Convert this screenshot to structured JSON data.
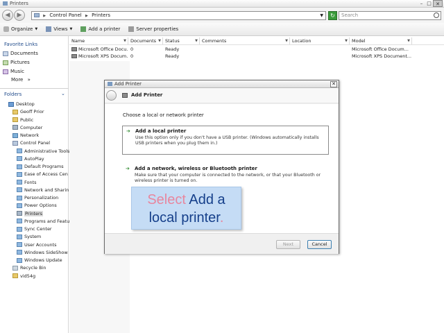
{
  "window": {
    "title": "Printers"
  },
  "window_buttons": {
    "minimize": "–",
    "maximize": "□",
    "close": "✕"
  },
  "address": {
    "crumbs": [
      "Control Panel",
      "Printers"
    ],
    "search_placeholder": "Search"
  },
  "toolbar": {
    "organize": "Organize",
    "views": "Views",
    "add_printer": "Add a printer",
    "server_properties": "Server properties"
  },
  "favorites": {
    "title": "Favorite Links",
    "items": [
      "Documents",
      "Pictures",
      "Music"
    ],
    "more": "More",
    "more_glyph": "»"
  },
  "folders": {
    "title": "Folders",
    "tree": [
      {
        "label": "Desktop",
        "icon": "desktop-icon"
      },
      {
        "label": "Geoff Prior",
        "icon": "folder-icon"
      },
      {
        "label": "Public",
        "icon": "folder-icon"
      },
      {
        "label": "Computer",
        "icon": "computer-icon"
      },
      {
        "label": "Network",
        "icon": "network-icon"
      },
      {
        "label": "Control Panel",
        "icon": "control-panel-icon"
      },
      {
        "label": "Administrative Tools",
        "icon": "cp-icon"
      },
      {
        "label": "AutoPlay",
        "icon": "cp-icon"
      },
      {
        "label": "Default Programs",
        "icon": "cp-icon"
      },
      {
        "label": "Ease of Access Cen",
        "icon": "cp-icon"
      },
      {
        "label": "Fonts",
        "icon": "cp-icon"
      },
      {
        "label": "Network and Sharin",
        "icon": "cp-icon"
      },
      {
        "label": "Personalization",
        "icon": "cp-icon"
      },
      {
        "label": "Power Options",
        "icon": "cp-icon"
      },
      {
        "label": "Printers",
        "icon": "printer-icon"
      },
      {
        "label": "Programs and Featu",
        "icon": "cp-icon"
      },
      {
        "label": "Sync Center",
        "icon": "cp-icon"
      },
      {
        "label": "System",
        "icon": "cp-icon"
      },
      {
        "label": "User Accounts",
        "icon": "cp-icon"
      },
      {
        "label": "Windows SideShow",
        "icon": "cp-icon"
      },
      {
        "label": "Windows Update",
        "icon": "cp-icon"
      },
      {
        "label": "Recycle Bin",
        "icon": "recycle-bin-icon"
      },
      {
        "label": "vid54g",
        "icon": "folder-icon"
      }
    ]
  },
  "list": {
    "columns": [
      "Name",
      "Documents",
      "Status",
      "Comments",
      "Location",
      "Model"
    ],
    "rows": [
      [
        "Microsoft Office Docu...",
        "0",
        "Ready",
        "",
        "",
        "Microsoft Office Docum..."
      ],
      [
        "Microsoft XPS Docum...",
        "0",
        "Ready",
        "",
        "",
        "Microsoft XPS Document..."
      ]
    ]
  },
  "dialog": {
    "title": "Add Printer",
    "header": "Add Printer",
    "heading": "Choose a local or network printer",
    "options": [
      {
        "title": "Add a local printer",
        "desc": "Use this option only if you don't have a USB printer. (Windows automatically installs USB printers when you plug them in.)"
      },
      {
        "title": "Add a network, wireless or Bluetooth printer",
        "desc": "Make sure that your computer is connected to the network, or that your Bluetooth or wireless printer is turned on."
      }
    ],
    "next": "Next",
    "cancel": "Cancel"
  },
  "callout": {
    "word1": "Select",
    "word2": "Add a",
    "word3": "local printer",
    "word4": "."
  },
  "colors": {
    "callout_bg": "#c5dcf5",
    "callout_pink": "#e8869e",
    "callout_navy": "#153f8a",
    "link_blue": "#1f4a8a"
  }
}
